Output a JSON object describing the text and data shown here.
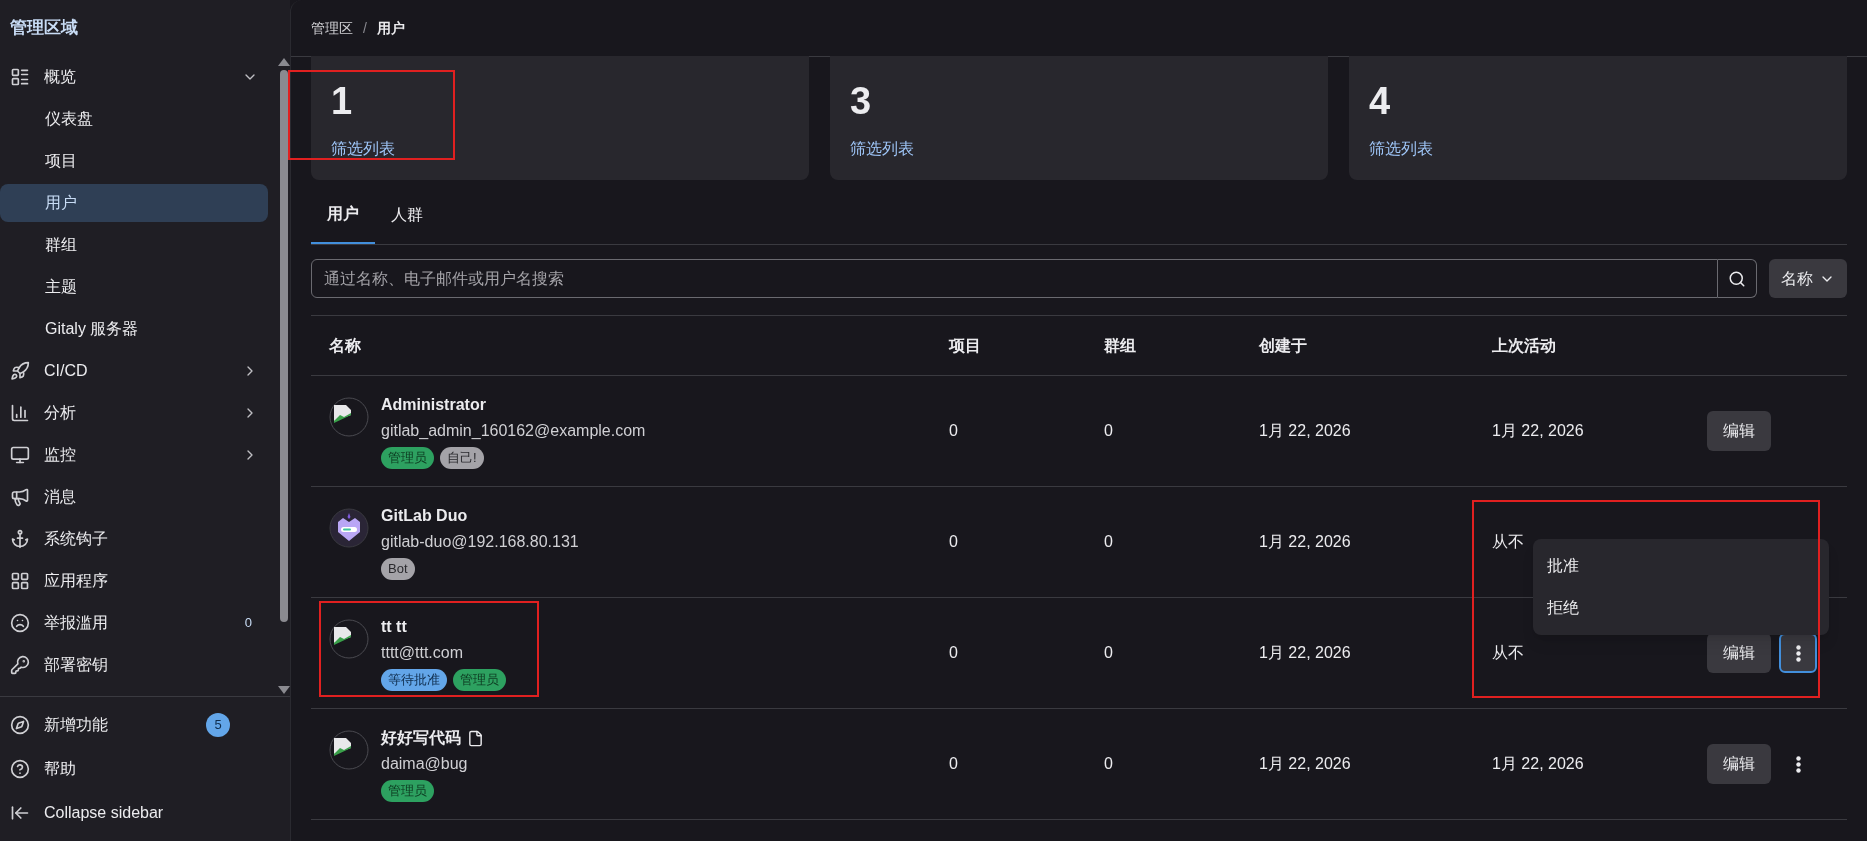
{
  "sidebar": {
    "title": "管理区域",
    "items": [
      {
        "label": "概览",
        "expanded": true,
        "children": [
          {
            "label": "仪表盘",
            "selected": false
          },
          {
            "label": "项目",
            "selected": false
          },
          {
            "label": "用户",
            "selected": true
          },
          {
            "label": "群组",
            "selected": false
          },
          {
            "label": "主题",
            "selected": false
          },
          {
            "label": "Gitaly 服务器",
            "selected": false
          }
        ]
      },
      {
        "label": "CI/CD",
        "expanded": false
      },
      {
        "label": "分析",
        "expanded": false
      },
      {
        "label": "监控",
        "expanded": false
      },
      {
        "label": "消息"
      },
      {
        "label": "系统钩子"
      },
      {
        "label": "应用程序"
      },
      {
        "label": "举报滥用",
        "count": "0"
      },
      {
        "label": "部署密钥"
      }
    ],
    "footer": [
      {
        "label": "新增功能",
        "badge": "5"
      },
      {
        "label": "帮助"
      },
      {
        "label": "Collapse sidebar"
      }
    ]
  },
  "breadcrumb": {
    "items": [
      "管理区",
      "用户"
    ],
    "separator": "/"
  },
  "stats": [
    {
      "value": "1",
      "link": "筛选列表",
      "highlighted": true
    },
    {
      "value": "3",
      "link": "筛选列表",
      "highlighted": false
    },
    {
      "value": "4",
      "link": "筛选列表",
      "highlighted": false
    }
  ],
  "tabs": [
    {
      "label": "用户",
      "selected": true
    },
    {
      "label": "人群",
      "selected": false
    }
  ],
  "search": {
    "placeholder": "通过名称、电子邮件或用户名搜索"
  },
  "sort": {
    "label": "名称"
  },
  "table": {
    "columns": [
      "名称",
      "项目",
      "群组",
      "创建于",
      "上次活动"
    ],
    "rows": [
      {
        "name": "Administrator",
        "email": "gitlab_admin_160162@example.com",
        "kind": "human",
        "has_note": false,
        "badges": [
          {
            "label": "管理员",
            "kind": "admin"
          },
          {
            "label": "自己!",
            "kind": "neutral"
          }
        ],
        "projects": "0",
        "groups": "0",
        "created": "1月 22, 2026",
        "last_activity": "1月 22, 2026",
        "edit": "编辑",
        "more": false,
        "highlighted": false
      },
      {
        "name": "GitLab Duo",
        "email": "gitlab-duo@192.168.80.131",
        "kind": "bot",
        "has_note": false,
        "badges": [
          {
            "label": "Bot",
            "kind": "neutral"
          }
        ],
        "projects": "0",
        "groups": "0",
        "created": "1月 22, 2026",
        "last_activity": "从不",
        "more": false,
        "highlighted": false
      },
      {
        "name": "tt tt",
        "email": "tttt@ttt.com",
        "kind": "human",
        "has_note": false,
        "badges": [
          {
            "label": "等待批准",
            "kind": "pending"
          },
          {
            "label": "管理员",
            "kind": "admin"
          }
        ],
        "projects": "0",
        "groups": "0",
        "created": "1月 22, 2026",
        "last_activity": "从不",
        "edit": "编辑",
        "more": true,
        "more_focused": true,
        "highlighted": true,
        "menu": {
          "items": [
            "批准",
            "拒绝"
          ],
          "highlighted": true
        }
      },
      {
        "name": "好好写代码",
        "email": "daima@bug",
        "kind": "human",
        "has_note": true,
        "badges": [
          {
            "label": "管理员",
            "kind": "admin"
          }
        ],
        "projects": "0",
        "groups": "0",
        "created": "1月 22, 2026",
        "last_activity": "1月 22, 2026",
        "edit": "编辑",
        "more": true,
        "more_focused": false,
        "highlighted": false
      }
    ]
  }
}
